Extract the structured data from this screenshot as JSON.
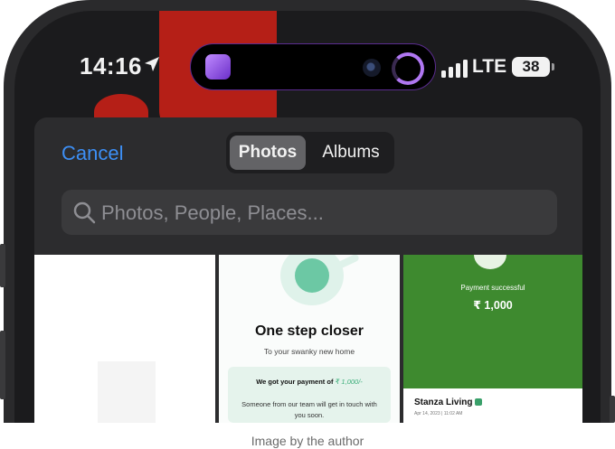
{
  "status_bar": {
    "time": "14:16",
    "icons": [
      "location-arrow-icon",
      "signal-bars-icon",
      "battery-icon"
    ],
    "network": "LTE",
    "battery_level": "38"
  },
  "dynamic_island": {
    "icons": [
      "app-activity-icon",
      "camera-icon",
      "progress-ring-icon"
    ]
  },
  "picker": {
    "cancel_label": "Cancel",
    "segments": [
      {
        "label": "Photos",
        "selected": true
      },
      {
        "label": "Albums",
        "selected": false
      }
    ],
    "search": {
      "placeholder": "Photos, People, Places...",
      "value": ""
    }
  },
  "photos": [
    {
      "kind": "blank"
    },
    {
      "title": "One step closer",
      "subtitle": "To your swanky new home",
      "payment_prefix": "We got your payment of",
      "payment_amount": "₹ 1,000/-",
      "message": "Someone from our team will get in touch with you soon."
    },
    {
      "status": "Payment successful",
      "amount": "₹ 1,000",
      "merchant": "Stanza Living",
      "date": "Apr 14, 2023 | 11:02 AM"
    }
  ],
  "caption": "Image by the author",
  "colors": {
    "accent": "#3d8ff5",
    "sheet": "#2c2c2e",
    "success_green": "#3e8a2f"
  }
}
